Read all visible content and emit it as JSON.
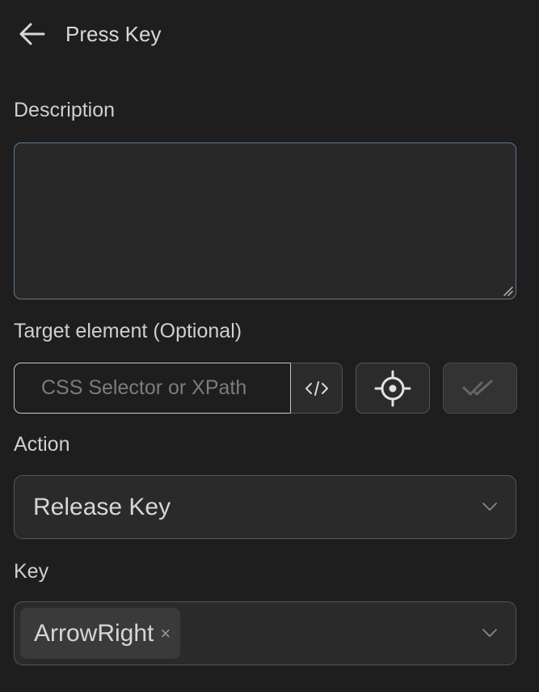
{
  "header": {
    "title": "Press Key",
    "back_icon": "arrow-left-icon"
  },
  "description": {
    "label": "Description",
    "value": ""
  },
  "target": {
    "label": "Target element (Optional)",
    "placeholder": "CSS Selector or XPath",
    "value": "",
    "code_icon": "code-icon",
    "pick_icon": "crosshair-icon",
    "verify_icon": "double-check-icon"
  },
  "action": {
    "label": "Action",
    "selected": "Release Key"
  },
  "key": {
    "label": "Key",
    "tags": [
      "ArrowRight"
    ],
    "remove_glyph": "×"
  },
  "colors": {
    "background": "#1e1e1e",
    "focused_border": "#5f7891",
    "input_border": "#c9c9c9"
  }
}
